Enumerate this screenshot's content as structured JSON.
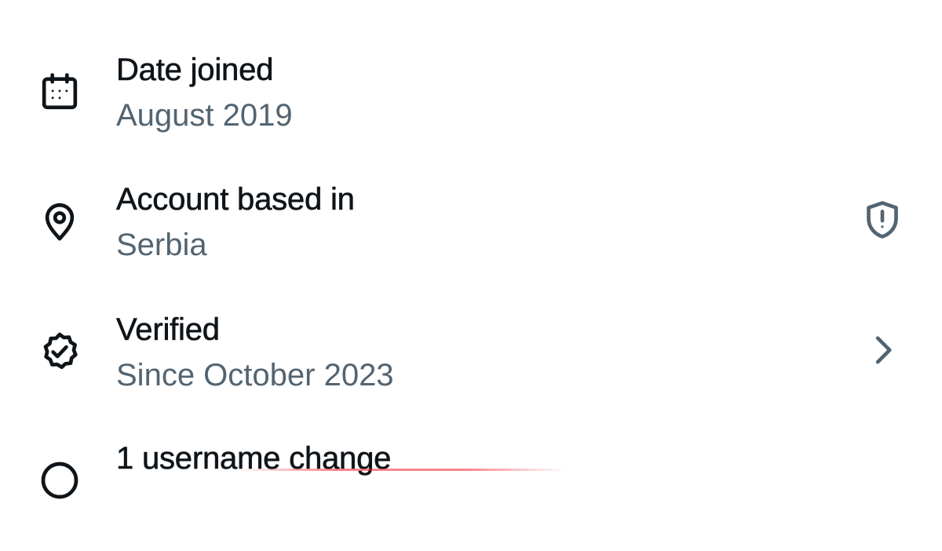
{
  "items": [
    {
      "title": "Date joined",
      "subtitle": "August 2019",
      "icon": "calendar-icon"
    },
    {
      "title": "Account based in",
      "subtitle": "Serbia",
      "icon": "location-pin-icon",
      "trailing_icon": "shield-alert-icon"
    },
    {
      "title": "Verified",
      "subtitle": "Since October 2023",
      "icon": "verified-badge-icon",
      "trailing_icon": "chevron-right-icon"
    },
    {
      "title": "1 username change",
      "icon": "username-change-icon"
    }
  ],
  "colors": {
    "primary_text": "#0f1419",
    "secondary_text": "#536471",
    "accent": "#f4212e"
  }
}
